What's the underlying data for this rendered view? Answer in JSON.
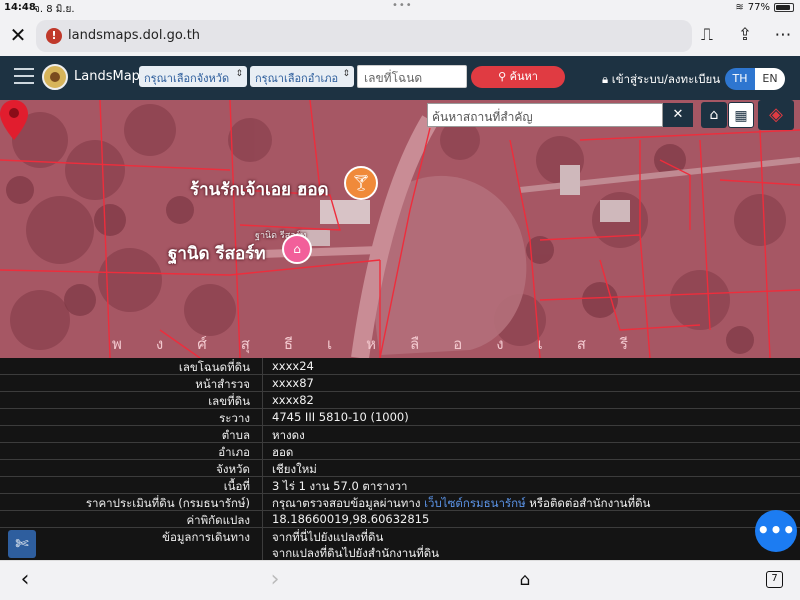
{
  "status_bar": {
    "time": "14:48",
    "date": "จ. 8 มิ.ย.",
    "battery": "77%",
    "battery_level": 0.77
  },
  "browser": {
    "url": "landsmaps.dol.go.th",
    "tabs_count": "7"
  },
  "header": {
    "brand": "LandsMaps",
    "province_select": "กรุณาเลือกจังหวัด",
    "district_select": "กรุณาเลือกอำเภอ",
    "deed_placeholder": "เลขที่โฉนด",
    "search_label": "ค้นหา",
    "login_label": "เข้าสู่ระบบ/ลงทะเบียน",
    "lang_th": "TH",
    "lang_en": "EN"
  },
  "map": {
    "place_search_placeholder": "ค้นหาสถานที่สำคัญ",
    "labels": {
      "shop": "ร้านรักเจ้าเอย ฮอด",
      "resort": "ฐานิด รีสอร์ท",
      "small": "ฐานิด รีสอร์ท",
      "road": "พงศ์สุธีเหลืองเสรี"
    }
  },
  "parcel_info": {
    "rows": [
      {
        "label": "เลขโฉนดที่ดิน",
        "value": "xxxx24"
      },
      {
        "label": "หน้าสำรวจ",
        "value": "xxxx87"
      },
      {
        "label": "เลขที่ดิน",
        "value": "xxxx82"
      },
      {
        "label": "ระวาง",
        "value": "4745 III 5810-10 (1000)"
      },
      {
        "label": "ตำบล",
        "value": "หางดง"
      },
      {
        "label": "อำเภอ",
        "value": "ฮอด"
      },
      {
        "label": "จังหวัด",
        "value": "เชียงใหม่"
      },
      {
        "label": "เนื้อที่",
        "value": "3 ไร่ 1 งาน 57.0 ตารางวา"
      }
    ],
    "appraisal": {
      "label": "ราคาประเมินที่ดิน (กรมธนารักษ์)",
      "prefix": "กรุณาตรวจสอบข้อมูลผ่านทาง",
      "link": "เว็บไซต์กรมธนารักษ์",
      "suffix": "หรือติดต่อสำนักงานที่ดิน"
    },
    "coordinates": {
      "label": "ค่าพิกัดแปลง",
      "value": "18.18660019,98.60632815"
    },
    "route": {
      "label": "ข้อมูลการเดินทาง",
      "link1": "จากที่นี่ไปยังแปลงที่ดิน",
      "link2": "จากแปลงที่ดินไปยังสำนักงานที่ดิน"
    }
  },
  "colors": {
    "header_bg": "#1d3242",
    "accent_red": "#e03b42",
    "accent_blue": "#2e76d0",
    "map_overlay": "#a85a66",
    "link": "#5b93e6"
  }
}
